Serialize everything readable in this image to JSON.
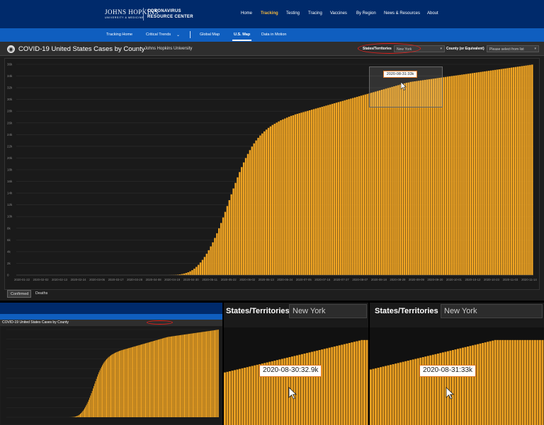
{
  "site": {
    "logo_main": "JOHNS HOPKINS",
    "logo_sub": "UNIVERSITY & MEDICINE",
    "center_name_1": "CORONAVIRUS",
    "center_name_2": "RESOURCE CENTER",
    "nav": [
      "Home",
      "Tracking",
      "Testing",
      "Tracing",
      "Vaccines",
      "By Region",
      "News & Resources",
      "About"
    ],
    "nav_active": "Tracking",
    "subnav": [
      "Tracking Home",
      "Critical Trends",
      "Global Map",
      "U.S. Map",
      "Data in Motion"
    ],
    "subnav_active": "U.S. Map"
  },
  "dashboard": {
    "title": "COVID-19 United States Cases by County",
    "subtitle": "Johns Hopkins University",
    "state_label": "States/Territories",
    "state_value": "New York",
    "county_label": "County (or Equivalent)",
    "county_placeholder": "Please select from list",
    "tabs": [
      "Confirmed",
      "Deaths"
    ],
    "active_tab": "Confirmed"
  },
  "tooltips": {
    "main": "2020-08-31:33k",
    "crop_left": "2020-08-30:32.9k",
    "crop_right": "2020-08-31:33k"
  },
  "colors": {
    "bar": "#f0a423",
    "bar_edge": "#c9851a",
    "nav_bg": "#002a6b",
    "subnav_bg": "#0f5ebf",
    "accent": "#f4b83e",
    "tooltip_border": "#e07a2a",
    "highlight_circle": "#e0201c"
  },
  "chart_data": {
    "type": "bar",
    "title": "",
    "xlabel": "",
    "ylabel": "",
    "ylim": [
      0,
      36000
    ],
    "y_ticks": [
      "0",
      "2k",
      "4k",
      "6k",
      "8k",
      "10k",
      "12k",
      "14k",
      "16k",
      "18k",
      "20k",
      "22k",
      "24k",
      "26k",
      "28k",
      "30k",
      "32k",
      "34k",
      "36k"
    ],
    "x_ticks": [
      "2020-01-22",
      "2020-02-02",
      "2020-02-13",
      "2020-02-24",
      "2020-03-06",
      "2020-03-17",
      "2020-03-28",
      "2020-04-08",
      "2020-04-19",
      "2020-04-30",
      "2020-05-11",
      "2020-05-22",
      "2020-06-02",
      "2020-06-13",
      "2020-06-24",
      "2020-07-05",
      "2020-07-16",
      "2020-07-27",
      "2020-08-07",
      "2020-08-18",
      "2020-08-29",
      "2020-09-09",
      "2020-09-20",
      "2020-10-01",
      "2020-10-12",
      "2020-10-23",
      "2020-11-03",
      "2020-11-14"
    ],
    "series": [
      {
        "values": [
          0,
          0,
          0,
          0,
          0,
          0,
          0,
          0,
          0,
          0,
          0,
          0,
          0,
          0,
          0,
          0,
          0,
          0,
          0,
          0,
          0,
          0,
          0,
          0,
          0,
          0,
          0,
          0,
          0,
          0,
          0,
          0,
          0,
          0,
          0,
          0,
          0,
          0,
          0,
          0,
          0,
          0,
          0,
          0,
          0,
          0,
          0,
          0,
          0,
          0,
          0,
          0,
          0,
          0,
          0,
          0,
          0,
          0,
          0,
          0,
          0,
          0,
          0,
          0,
          0,
          0,
          0,
          0,
          0,
          0,
          0,
          0,
          0,
          0,
          10,
          20,
          30,
          50,
          80,
          120,
          180,
          260,
          360,
          480,
          640,
          840,
          1100,
          1400,
          1750,
          2150,
          2600,
          3100,
          3650,
          4250,
          4900,
          5600,
          6350,
          7150,
          8000,
          8900,
          9850,
          10800,
          11800,
          12800,
          13800,
          14800,
          15750,
          16700,
          17600,
          18450,
          19250,
          20000,
          20700,
          21350,
          21950,
          22500,
          23000,
          23450,
          23850,
          24200,
          24550,
          24850,
          25150,
          25400,
          25650,
          25850,
          26050,
          26250,
          26450,
          26600,
          26750,
          26900,
          27050,
          27200,
          27300,
          27450,
          27550,
          27650,
          27750,
          27850,
          27950,
          28050,
          28150,
          28250,
          28350,
          28450,
          28550,
          28650,
          28750,
          28850,
          28950,
          29050,
          29150,
          29250,
          29350,
          29450,
          29550,
          29650,
          29750,
          29850,
          29950,
          30050,
          30150,
          30250,
          30350,
          30450,
          30550,
          30650,
          30750,
          30850,
          30950,
          31050,
          31150,
          31250,
          31350,
          31450,
          31550,
          31650,
          31750,
          31850,
          31950,
          32050,
          32150,
          32250,
          32350,
          32450,
          32550,
          32650,
          32750,
          32850,
          32900,
          33000,
          33050,
          33100,
          33150,
          33200,
          33250,
          33300,
          33350,
          33400,
          33450,
          33500,
          33550,
          33600,
          33650,
          33700,
          33750,
          33800,
          33850,
          33900,
          33950,
          34000,
          34050,
          34100,
          34150,
          34200,
          34250,
          34300,
          34350,
          34400,
          34450,
          34500,
          34550,
          34600,
          34650,
          34700,
          34750,
          34800,
          34850,
          34900,
          34950,
          35000,
          35050,
          35100,
          35150,
          35200,
          35250,
          35300,
          35350,
          35400,
          35450,
          35500,
          35550,
          35600,
          35650,
          35700,
          35750,
          35800,
          35850,
          35900,
          35950
        ]
      }
    ],
    "grid": true,
    "legend": "none"
  }
}
